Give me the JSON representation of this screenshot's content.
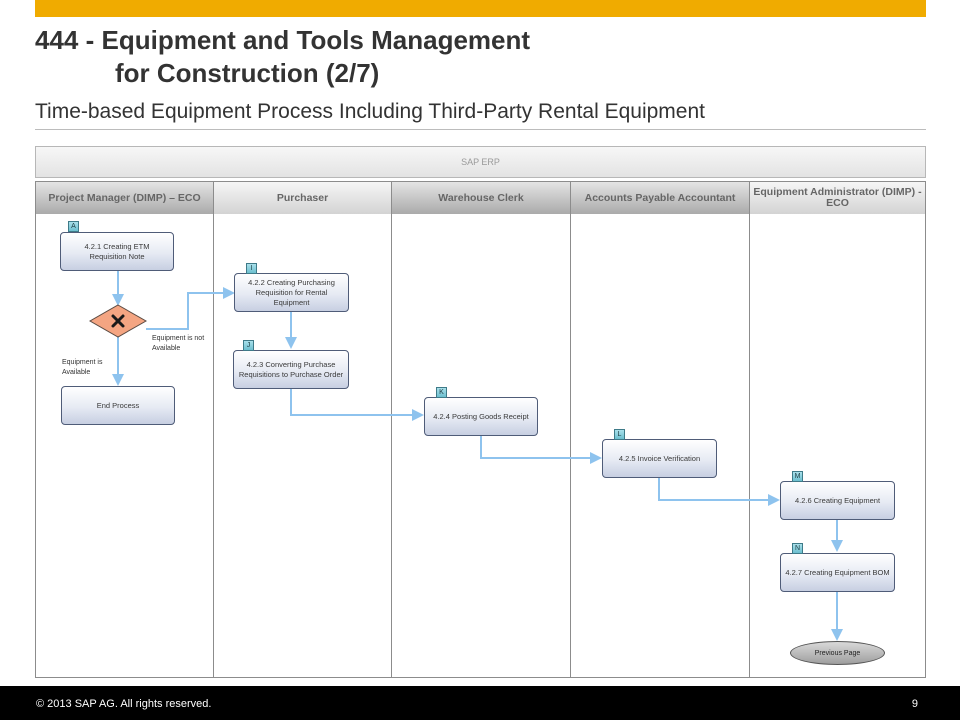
{
  "header": {
    "title_line1": "444 - Equipment and Tools Management",
    "title_line2": "for Construction (2/7)",
    "subtitle": "Time-based Equipment Process Including Third-Party Rental Equipment"
  },
  "system": "SAP ERP",
  "lanes": [
    "Project Manager (DIMP) – ECO",
    "Purchaser",
    "Warehouse Clerk",
    "Accounts Payable Accountant",
    "Equipment Administrator (DIMP) - ECO"
  ],
  "steps": {
    "a": {
      "tag": "A",
      "label": "4.2.1 Creating ETM Requisition Note"
    },
    "i": {
      "tag": "I",
      "label": "4.2.2 Creating Purchasing Requisition for Rental Equipment"
    },
    "j": {
      "tag": "J",
      "label": "4.2.3 Converting Purchase Requisitions to Purchase Order"
    },
    "k": {
      "tag": "K",
      "label": "4.2.4 Posting Goods Receipt"
    },
    "l": {
      "tag": "L",
      "label": "4.2.5 Invoice Verification"
    },
    "m": {
      "tag": "M",
      "label": "4.2.6 Creating Equipment"
    },
    "n": {
      "tag": "N",
      "label": "4.2.7 Creating Equipment BOM"
    },
    "end": {
      "label": "End Process"
    }
  },
  "notes": {
    "available": "Equipment is Available",
    "not_available": "Equipment is not Available"
  },
  "previous_page": "Previous Page",
  "footer": {
    "copyright": "© 2013 SAP AG. All rights reserved.",
    "page": "9"
  },
  "colors": {
    "accent": "#f0ab00",
    "connector": "#8ec3ee",
    "gateway": "#f4a582"
  }
}
